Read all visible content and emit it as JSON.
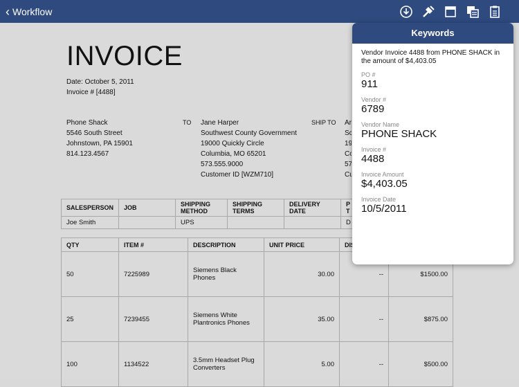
{
  "nav": {
    "back_label": "Workflow",
    "icons": [
      "download-icon",
      "keywords-icon",
      "document-view-icon",
      "copies-icon",
      "clipboard-icon"
    ]
  },
  "invoice": {
    "title": "INVOICE",
    "date": "Date: October 5, 2011",
    "number": "Invoice # [4488]",
    "from": [
      "Phone Shack",
      "5546 South Street",
      "Johnstown, PA 15901",
      "814.123.4567"
    ],
    "to_label": "TO",
    "to": [
      "Jane Harper",
      "Southwest County Government",
      "19000 Quickly Circle",
      "Columbia, MO 65201",
      "573.555.9000",
      "Customer ID [WZM710]"
    ],
    "ship_to_label": "SHIP TO",
    "ship_to": [
      "Ar",
      "Sc",
      "19",
      "Co",
      "57",
      "Cu"
    ],
    "sales_headers": [
      "SALESPERSON",
      "JOB",
      "SHIPPING METHOD",
      "SHIPPING TERMS",
      "DELIVERY DATE",
      "P T"
    ],
    "sales_row": [
      "Joe Smith",
      "",
      "UPS",
      "",
      "",
      "D"
    ],
    "item_headers": [
      "QTY",
      "ITEM #",
      "DESCRIPTION",
      "UNIT PRICE",
      "DIS",
      ""
    ],
    "items": [
      {
        "qty": "50",
        "item": "7225989",
        "desc": "Siemens Black Phones",
        "price": "30.00",
        "disc": "--",
        "total": "$1500.00"
      },
      {
        "qty": "25",
        "item": "7239455",
        "desc": "Siemens White Plantronics Phones",
        "price": "35.00",
        "disc": "--",
        "total": "$875.00"
      },
      {
        "qty": "100",
        "item": "1134522",
        "desc": "3.5mm Headset Plug Converters",
        "price": "5.00",
        "disc": "--",
        "total": "$500.00"
      }
    ]
  },
  "keywords": {
    "title": "Keywords",
    "summary": "Vendor Invoice 4488 from PHONE SHACK in the amount of $4,403.05",
    "fields": [
      {
        "label": "PO #",
        "value": "911"
      },
      {
        "label": "Vendor #",
        "value": "6789"
      },
      {
        "label": "Vendor Name",
        "value": "PHONE SHACK"
      },
      {
        "label": "Invoice #",
        "value": "4488"
      },
      {
        "label": "Invoice Amount",
        "value": "$4,403.05"
      },
      {
        "label": "Invoice Date",
        "value": "10/5/2011"
      }
    ]
  },
  "colors": {
    "navbar": "#2e4a7e",
    "page_bg": "#d9d9d9"
  }
}
